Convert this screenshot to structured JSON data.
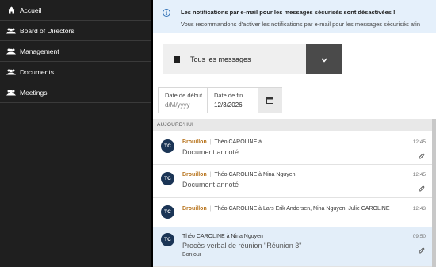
{
  "sidebar": {
    "items": [
      {
        "label": "Accueil",
        "icon": "home-icon"
      },
      {
        "label": "Board of Directors",
        "icon": "people-icon"
      },
      {
        "label": "Management",
        "icon": "people-icon"
      },
      {
        "label": "Documents",
        "icon": "people-icon"
      },
      {
        "label": "Meetings",
        "icon": "people-icon"
      }
    ]
  },
  "banner": {
    "title": "Les notifications par e-mail pour les messages sécurisés sont désactivées !",
    "text": "Vous recommandons d'activer les notifications par e-mail pour les messages sécurisés afin"
  },
  "filter": {
    "label": "Tous les messages"
  },
  "dates": {
    "start_label": "Date de début",
    "start_placeholder": "d/M/yyyy",
    "end_label": "Date de fin",
    "end_value": "12/3/2026"
  },
  "section": {
    "title": "AUJOURD'HUI"
  },
  "messages": [
    {
      "initials": "TC",
      "status": "Brouillon",
      "participants": "Théo CAROLINE à",
      "subject": "Document annoté",
      "time": "12:45"
    },
    {
      "initials": "TC",
      "status": "Brouillon",
      "participants": "Théo CAROLINE à Nina Nguyen",
      "subject": "Document annoté",
      "time": "12:45"
    },
    {
      "initials": "TC",
      "status": "Brouillon",
      "participants": "Théo CAROLINE à Lars Erik Andersen, Nina Nguyen, Julie CAROLINE",
      "subject": "",
      "time": "12:43"
    },
    {
      "initials": "TC",
      "status": "",
      "participants": "Théo CAROLINE à Nina Nguyen",
      "subject": "Procès-verbal de réunion \"Réunion 3\"",
      "preview": "Bonjour",
      "time": "09:50"
    }
  ],
  "colors": {
    "sidebar_bg": "#1f1f1f",
    "banner_bg": "#e5f0fb",
    "avatar_bg": "#1b3556",
    "draft": "#b7731c",
    "selected_row": "#e3eef9"
  }
}
